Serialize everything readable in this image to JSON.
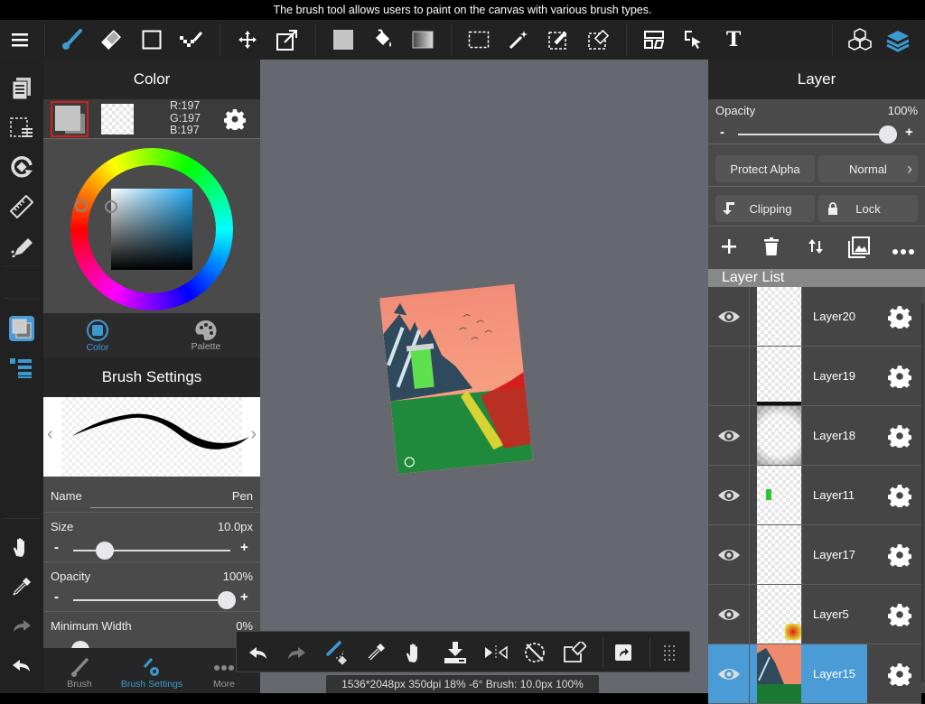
{
  "tooltip": "The brush tool allows users to paint on the canvas with various brush types.",
  "toolbar": {
    "tools": [
      {
        "name": "menu-icon"
      },
      {
        "name": "brush-icon",
        "active": true
      },
      {
        "name": "eraser-icon"
      },
      {
        "name": "shape-icon"
      },
      {
        "name": "dot-pen-icon"
      },
      {
        "name": "move-icon"
      },
      {
        "name": "transform-icon"
      },
      {
        "name": "fill-color-icon"
      },
      {
        "name": "bucket-icon"
      },
      {
        "name": "gradient-icon"
      },
      {
        "name": "select-rect-icon"
      },
      {
        "name": "magic-wand-icon"
      },
      {
        "name": "select-pen-icon"
      },
      {
        "name": "select-eraser-icon"
      },
      {
        "name": "frame-divider-icon"
      },
      {
        "name": "operation-icon"
      },
      {
        "name": "text-icon"
      },
      {
        "name": "3d-material-icon"
      },
      {
        "name": "layers-icon",
        "active": true
      }
    ],
    "text_label": "T"
  },
  "color_panel": {
    "title": "Color",
    "rgb": {
      "r": "R:197",
      "g": "G:197",
      "b": "B:197"
    },
    "primary_color": "#c5c5c5",
    "tabs": [
      {
        "label": "Color",
        "active": true
      },
      {
        "label": "Palette",
        "active": false
      }
    ]
  },
  "brush_panel": {
    "title": "Brush Settings",
    "name_label": "Name",
    "name_value": "Pen",
    "size_label": "Size",
    "size_value": "10.0px",
    "size_fraction": 0.2,
    "opacity_label": "Opacity",
    "opacity_value": "100%",
    "opacity_fraction": 1.0,
    "min_width_label": "Minimum Width",
    "min_width_value": "0%",
    "minus": "-",
    "plus": "+"
  },
  "bottom_tabs": [
    {
      "label": "Brush"
    },
    {
      "label": "Brush Settings",
      "active": true
    },
    {
      "label": "More"
    }
  ],
  "status": "1536*2048px 350dpi 18% -6° Brush: 10.0px 100%",
  "layer_panel": {
    "title": "Layer",
    "opacity_label": "Opacity",
    "opacity_value": "100%",
    "opacity_fraction": 1.0,
    "protect_alpha": "Protect Alpha",
    "blend_mode": "Normal",
    "clipping": "Clipping",
    "lock": "Lock",
    "list_title": "Layer List",
    "layers": [
      {
        "name": "Layer20",
        "visible": true
      },
      {
        "name": "Layer19",
        "visible": false
      },
      {
        "name": "Layer18",
        "visible": true
      },
      {
        "name": "Layer11",
        "visible": true
      },
      {
        "name": "Layer17",
        "visible": true
      },
      {
        "name": "Layer5",
        "visible": true
      },
      {
        "name": "Layer15",
        "visible": true,
        "selected": true
      }
    ]
  },
  "colors": {
    "accent": "#3d9ad1",
    "selected_row": "#4a9bd6",
    "swatch_border": "#d0201c"
  }
}
